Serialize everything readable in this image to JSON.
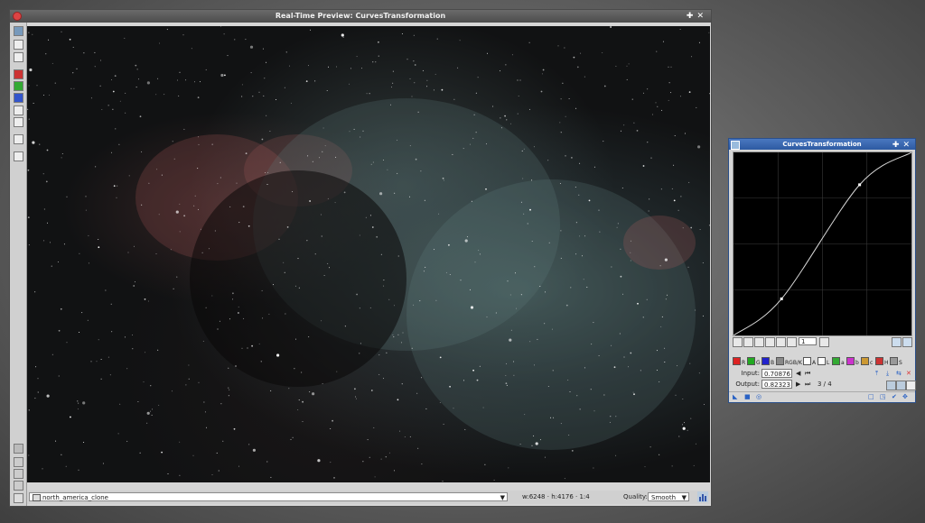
{
  "preview": {
    "title": "Real-Time Preview: CurvesTransformation",
    "view_name": "north_america_clone",
    "dims": "w:6248 · h:4176 · 1:4",
    "quality_label": "Quality:",
    "quality_value": "Smooth",
    "title_buttons": "✚✕"
  },
  "curves": {
    "title": "CurvesTransformation",
    "title_buttons": "✚✕",
    "zoom": "1",
    "channels": [
      {
        "key": "R",
        "label": "R",
        "color": "#d22"
      },
      {
        "key": "G",
        "label": "G",
        "color": "#2a2"
      },
      {
        "key": "B",
        "label": "B",
        "color": "#22c"
      },
      {
        "key": "RGBK",
        "label": "RGB/K",
        "color": "#888"
      },
      {
        "key": "A",
        "label": "A",
        "color": "#fff"
      },
      {
        "key": "L",
        "label": "L",
        "color": "#fff"
      },
      {
        "key": "a",
        "label": "a",
        "color": "#3a3"
      },
      {
        "key": "b",
        "label": "b",
        "color": "#c3c"
      },
      {
        "key": "c",
        "label": "c",
        "color": "#c93"
      },
      {
        "key": "H",
        "label": "H",
        "color": "#c33"
      },
      {
        "key": "S",
        "label": "S",
        "color": "#999"
      }
    ],
    "input_label": "Input:",
    "input_value": "0.70876",
    "output_label": "Output:",
    "output_value": "0.82323",
    "point_index": "3 / 4",
    "curve_points": [
      [
        0,
        0
      ],
      [
        0.27,
        0.2
      ],
      [
        0.70876,
        0.82323
      ],
      [
        1,
        1
      ]
    ]
  }
}
